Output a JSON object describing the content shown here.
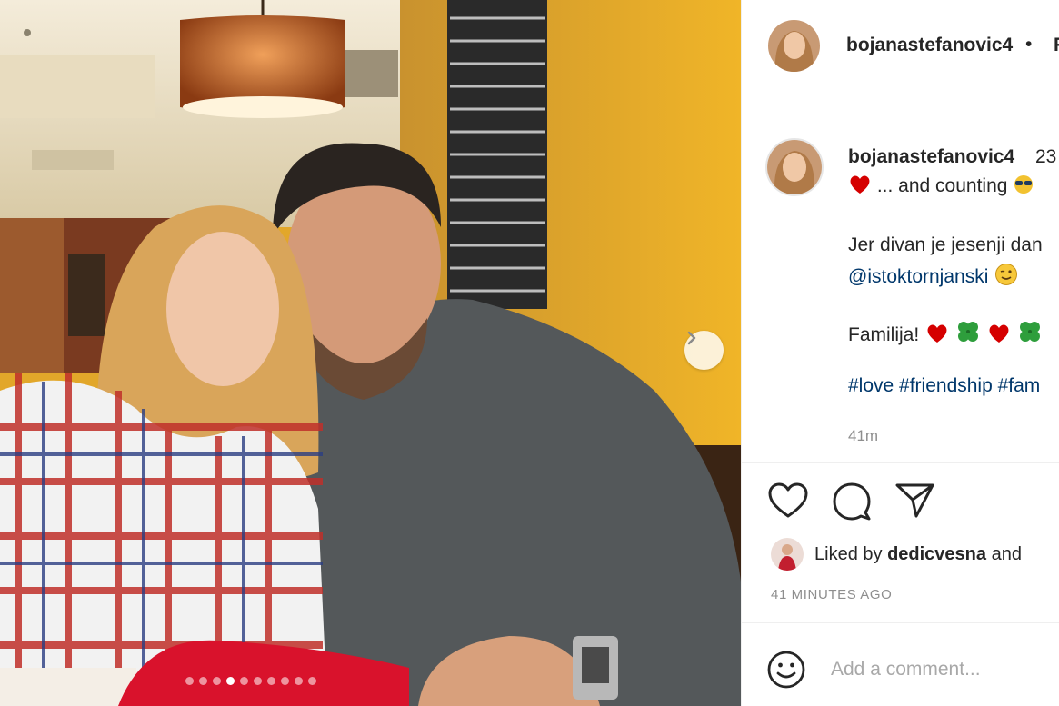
{
  "post": {
    "username": "bojanastefanovic4",
    "header_separator": "•",
    "follow_label": "F",
    "carousel": {
      "total": 10,
      "active": 3
    }
  },
  "caption": {
    "username": "bojanastefanovic4",
    "time_prefix": "23",
    "line1_text": "... and counting",
    "line2_text": "Jer divan je jesenji dan",
    "mention": "@istoktornjanski",
    "line3_text": "Familija!",
    "hashtags": "#love #friendship #fam",
    "age": "41m"
  },
  "likes": {
    "prefix": "Liked by",
    "user": "dedicvesna",
    "suffix": "and"
  },
  "posted_ago": "41 MINUTES AGO",
  "comment": {
    "placeholder": "Add a comment..."
  },
  "icons": {
    "like": "heart-outline-icon",
    "comment": "speech-bubble-icon",
    "share": "paper-plane-icon",
    "next": "chevron-right-icon",
    "emoji": "smiley-face-icon"
  },
  "colors": {
    "link": "#00376b",
    "muted": "#8e8e8e",
    "heart": "#d50000",
    "clover": "#2e9e3c"
  }
}
